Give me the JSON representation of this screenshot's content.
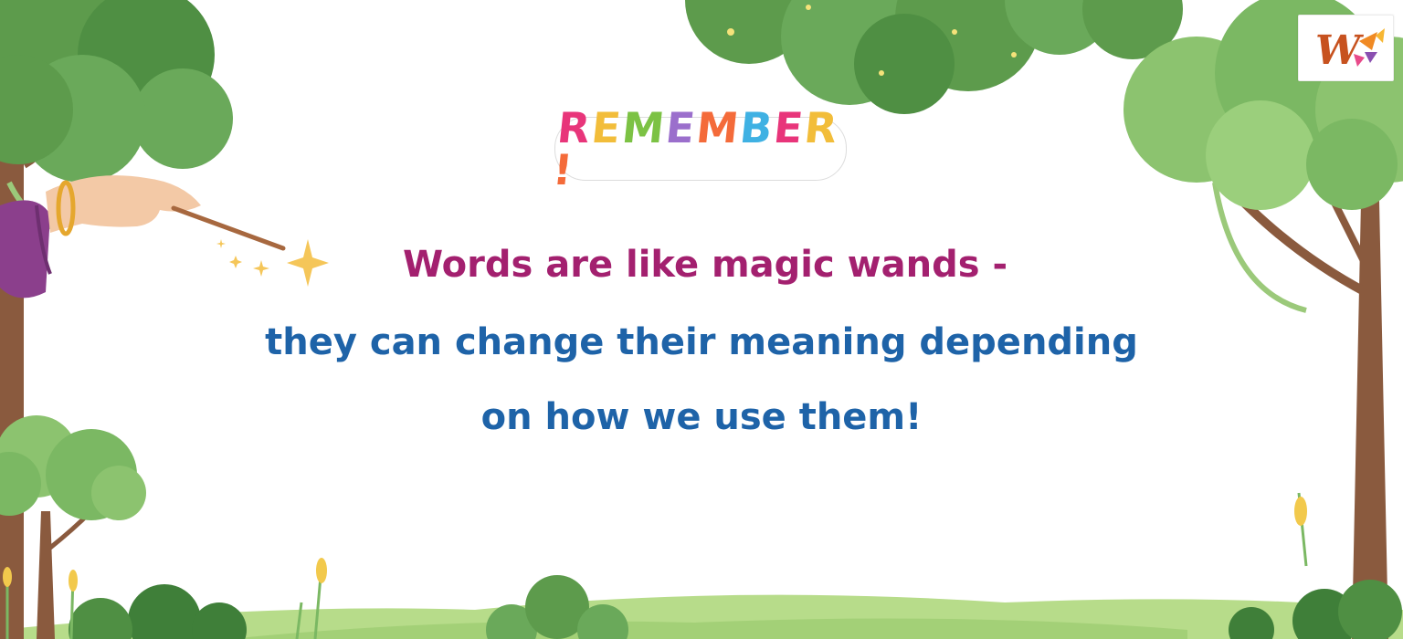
{
  "badge": {
    "letters": [
      {
        "char": "R",
        "color": "#e8357a"
      },
      {
        "char": "E",
        "color": "#f2bd3a"
      },
      {
        "char": "M",
        "color": "#7cc244"
      },
      {
        "char": "E",
        "color": "#9b6fcc"
      },
      {
        "char": "M",
        "color": "#f46b3a"
      },
      {
        "char": "B",
        "color": "#3fb1e3"
      },
      {
        "char": "E",
        "color": "#e8357a"
      },
      {
        "char": "R",
        "color": "#f2bd3a"
      },
      {
        "char": "!",
        "color": "#f46b3a"
      }
    ]
  },
  "quote": {
    "line1": "Words are like magic wands -",
    "line2": "they can change their meaning depending",
    "line3": "on how we use them!"
  },
  "logo": {
    "letter": "W",
    "letter_color": "#c7521f",
    "accent_colors": [
      "#f08a24",
      "#8a4fb0",
      "#e84a8a",
      "#f7b733"
    ]
  },
  "colors": {
    "quote_magenta": "#a3206f",
    "quote_blue": "#1e63a8",
    "foliage_dark": "#4f8f43",
    "foliage_mid": "#6aa95a",
    "foliage_light": "#8cc36f",
    "trunk": "#8a5a3e",
    "grass": "#b7dc8a",
    "sleeve": "#8b3f8c",
    "skin": "#f3c9a6",
    "wand": "#a7683f",
    "sparkle": "#f5c659"
  }
}
